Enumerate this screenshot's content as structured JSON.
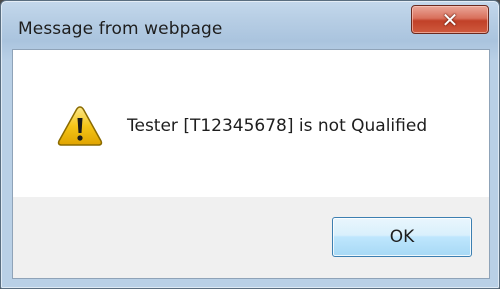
{
  "dialog": {
    "title": "Message from webpage",
    "message": "Tester [T12345678] is not Qualified",
    "icon": "warning-icon",
    "close_button": {
      "icon": "close-icon",
      "glyph": "✕"
    },
    "buttons": {
      "ok_label": "OK"
    },
    "colors": {
      "close_button": "#c14128",
      "ok_button_border": "#3c7fb1",
      "warning_fill": "#f5c518"
    }
  }
}
